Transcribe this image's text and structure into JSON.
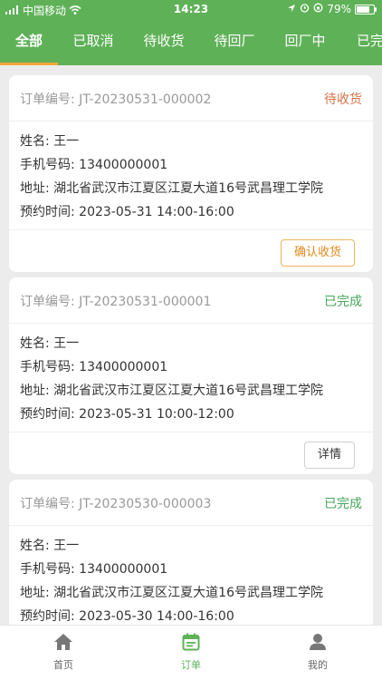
{
  "status_bar": {
    "carrier": "中国移动",
    "time": "14:23",
    "battery": "79%",
    "battery_level": 0.79
  },
  "tabs": [
    {
      "label": "全部",
      "active": true
    },
    {
      "label": "已取消"
    },
    {
      "label": "待收货"
    },
    {
      "label": "待回厂"
    },
    {
      "label": "回厂中"
    },
    {
      "label": "已完"
    }
  ],
  "orders": [
    {
      "order_no": "订单编号: JT-20230531-000002",
      "status": "待收货",
      "name": "姓名: 王一",
      "phone": "手机号码: 13400000001",
      "address": "地址: 湖北省武汉市江夏区江夏大道16号武昌理工学院",
      "time": "预约时间: 2023-05-31 14:00-16:00",
      "action": "确认收货"
    },
    {
      "order_no": "订单编号: JT-20230531-000001",
      "status": "已完成",
      "name": "姓名: 王一",
      "phone": "手机号码: 13400000001",
      "address": "地址: 湖北省武汉市江夏区江夏大道16号武昌理工学院",
      "time": "预约时间: 2023-05-31 10:00-12:00",
      "action": "详情"
    },
    {
      "order_no": "订单编号: JT-20230530-000003",
      "status": "已完成",
      "name": "姓名: 王一",
      "phone": "手机号码: 13400000001",
      "address": "地址: 湖北省武汉市江夏区江夏大道16号武昌理工学院",
      "time": "预约时间: 2023-05-30 14:00-16:00"
    }
  ],
  "bottom_nav": [
    {
      "label": "首页",
      "icon": "home-icon"
    },
    {
      "label": "订单",
      "icon": "order-icon",
      "active": true
    },
    {
      "label": "我的",
      "icon": "profile-icon"
    }
  ],
  "colors": {
    "primary": "#5fb158",
    "tab_indicator": "#f3a63a",
    "status_pending": "#d6734a",
    "status_done": "#46a55b"
  }
}
